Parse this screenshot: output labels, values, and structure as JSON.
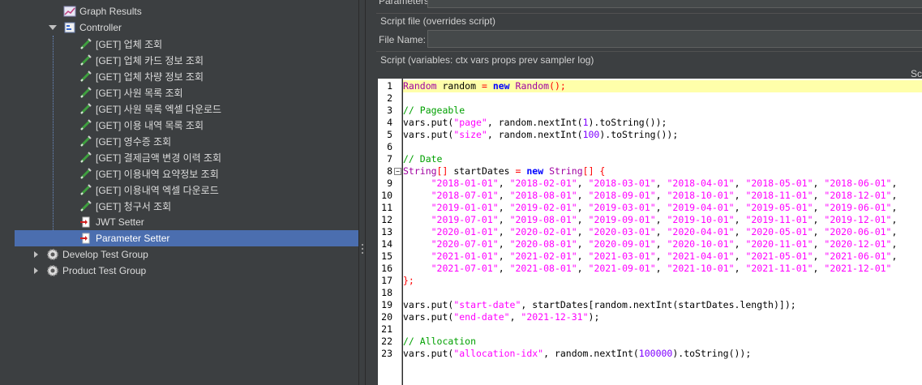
{
  "tree": {
    "items": [
      {
        "label": "Graph Results",
        "icon": "graph-results-icon"
      },
      {
        "label": "Controller",
        "icon": "controller-icon"
      },
      {
        "label": "[GET] 업체 조회",
        "icon": "http-sampler-icon"
      },
      {
        "label": "[GET] 업체 카드 정보 조회",
        "icon": "http-sampler-icon"
      },
      {
        "label": "[GET] 업체 차량 정보 조회",
        "icon": "http-sampler-icon"
      },
      {
        "label": "[GET] 사원 목록 조회",
        "icon": "http-sampler-icon"
      },
      {
        "label": "[GET] 사원 목록 엑셀 다운로드",
        "icon": "http-sampler-icon"
      },
      {
        "label": "[GET] 이용 내역 목록 조회",
        "icon": "http-sampler-icon"
      },
      {
        "label": "[GET] 영수증 조회",
        "icon": "http-sampler-icon"
      },
      {
        "label": "[GET] 결제금액 변경 이력 조회",
        "icon": "http-sampler-icon"
      },
      {
        "label": "[GET] 이용내역 요약정보 조회",
        "icon": "http-sampler-icon"
      },
      {
        "label": "[GET] 이용내역 엑셀 다운로드",
        "icon": "http-sampler-icon"
      },
      {
        "label": "[GET] 청구서 조회",
        "icon": "http-sampler-icon"
      },
      {
        "label": "JWT Setter",
        "icon": "preprocessor-icon"
      },
      {
        "label": "Parameter Setter",
        "icon": "preprocessor-icon"
      },
      {
        "label": "Develop Test Group",
        "icon": "thread-group-icon"
      },
      {
        "label": "Product Test Group",
        "icon": "thread-group-icon"
      }
    ]
  },
  "right": {
    "parameters_label": "Parameters:",
    "script_file_label": "Script file (overrides script)",
    "file_name_label": "File Name:",
    "file_name_value": "",
    "script_label": "Script (variables: ctx vars props prev sampler log)",
    "corner_label": "Sc"
  },
  "editor": {
    "lines": [
      "1",
      "2",
      "3",
      "4",
      "5",
      "6",
      "7",
      "8",
      "9",
      "10",
      "11",
      "12",
      "13",
      "14",
      "15",
      "16",
      "17",
      "18",
      "19",
      "20",
      "21",
      "22",
      "23"
    ],
    "code": {
      "l1": [
        "Random",
        " random ",
        "=",
        " ",
        "new",
        " ",
        "Random",
        "();"
      ],
      "c3": "// Pageable",
      "l4": [
        "vars.put(",
        "\"page\"",
        ", random.nextInt(",
        "1",
        ").toString());"
      ],
      "l5": [
        "vars.put(",
        "\"size\"",
        ", random.nextInt(",
        "100",
        ").toString());"
      ],
      "c7": "// Date",
      "l8": [
        "String",
        "[]",
        " startDates ",
        "=",
        " ",
        "new",
        " ",
        "String",
        "[] {"
      ],
      "d9": [
        "\"2018-01-01\"",
        "\"2018-02-01\"",
        "\"2018-03-01\"",
        "\"2018-04-01\"",
        "\"2018-05-01\"",
        "\"2018-06-01\""
      ],
      "d10": [
        "\"2018-07-01\"",
        "\"2018-08-01\"",
        "\"2018-09-01\"",
        "\"2018-10-01\"",
        "\"2018-11-01\"",
        "\"2018-12-01\""
      ],
      "d11": [
        "\"2019-01-01\"",
        "\"2019-02-01\"",
        "\"2019-03-01\"",
        "\"2019-04-01\"",
        "\"2019-05-01\"",
        "\"2019-06-01\""
      ],
      "d12": [
        "\"2019-07-01\"",
        "\"2019-08-01\"",
        "\"2019-09-01\"",
        "\"2019-10-01\"",
        "\"2019-11-01\"",
        "\"2019-12-01\""
      ],
      "d13": [
        "\"2020-01-01\"",
        "\"2020-02-01\"",
        "\"2020-03-01\"",
        "\"2020-04-01\"",
        "\"2020-05-01\"",
        "\"2020-06-01\""
      ],
      "d14": [
        "\"2020-07-01\"",
        "\"2020-08-01\"",
        "\"2020-09-01\"",
        "\"2020-10-01\"",
        "\"2020-11-01\"",
        "\"2020-12-01\""
      ],
      "d15": [
        "\"2021-01-01\"",
        "\"2021-02-01\"",
        "\"2021-03-01\"",
        "\"2021-04-01\"",
        "\"2021-05-01\"",
        "\"2021-06-01\""
      ],
      "d16": [
        "\"2021-07-01\"",
        "\"2021-08-01\"",
        "\"2021-09-01\"",
        "\"2021-10-01\"",
        "\"2021-11-01\"",
        "\"2021-12-01\""
      ],
      "l17": "};",
      "l19": [
        "vars.put(",
        "\"start-date\"",
        ", startDates[random.nextInt(startDates.length)]);"
      ],
      "l20": [
        "vars.put(",
        "\"end-date\"",
        ", ",
        "\"2021-12-31\"",
        ");"
      ],
      "c22": "// Allocation",
      "l23": [
        "vars.put(",
        "\"allocation-idx\"",
        ", random.nextInt(",
        "100000",
        ").toString());"
      ]
    }
  }
}
